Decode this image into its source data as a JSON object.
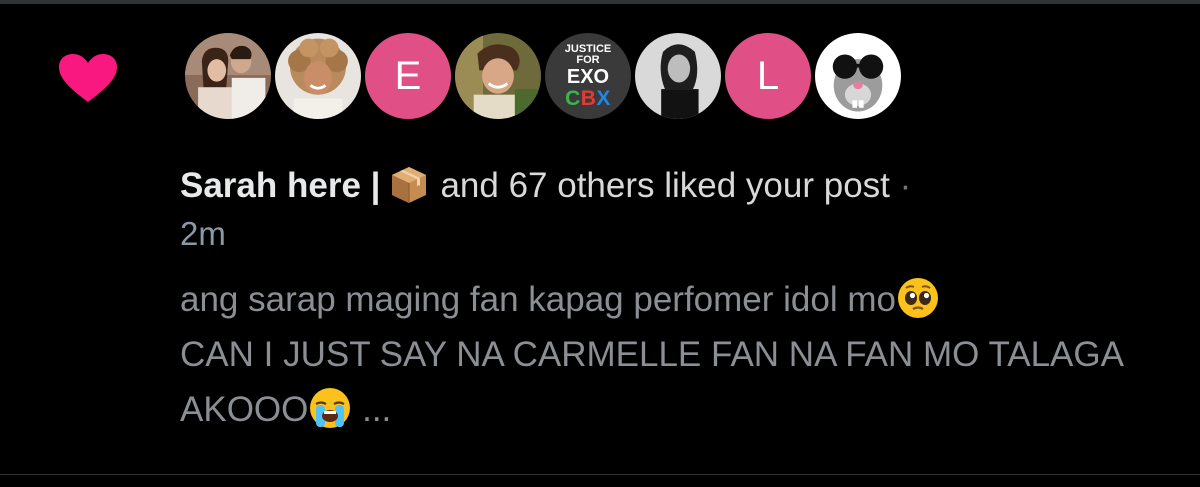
{
  "notification": {
    "type_icon": "heart-icon",
    "accent_color": "#f91880",
    "avatars": [
      {
        "name": "avatar-couple-photo",
        "kind": "photo"
      },
      {
        "name": "avatar-curly-hair-photo",
        "kind": "photo"
      },
      {
        "name": "avatar-letter-e",
        "kind": "letter",
        "letter": "E"
      },
      {
        "name": "avatar-smiling-man-photo",
        "kind": "photo"
      },
      {
        "name": "avatar-justice-for-exo-cbx",
        "kind": "logo",
        "lines": [
          "JUSTICE",
          "FOR",
          "EXO",
          "CBX"
        ]
      },
      {
        "name": "avatar-bw-woman-photo",
        "kind": "photo"
      },
      {
        "name": "avatar-letter-l",
        "kind": "letter",
        "letter": "L"
      },
      {
        "name": "avatar-mouse-sunglasses-photo",
        "kind": "photo"
      }
    ],
    "actor_name": "Sarah here |",
    "actor_emoji": "package-icon",
    "summary": "and 67 others liked your post",
    "separator": "·",
    "timestamp": "2m",
    "post_text_line1": "ang sarap maging fan kapag perfomer idol mo",
    "post_text_line2": "CAN I JUST SAY NA CARMELLE FAN NA FAN MO TALAGA AKOOO",
    "ellipsis": " ...",
    "emoji_1": "pleading-face-icon",
    "emoji_2": "loudly-crying-face-icon"
  }
}
